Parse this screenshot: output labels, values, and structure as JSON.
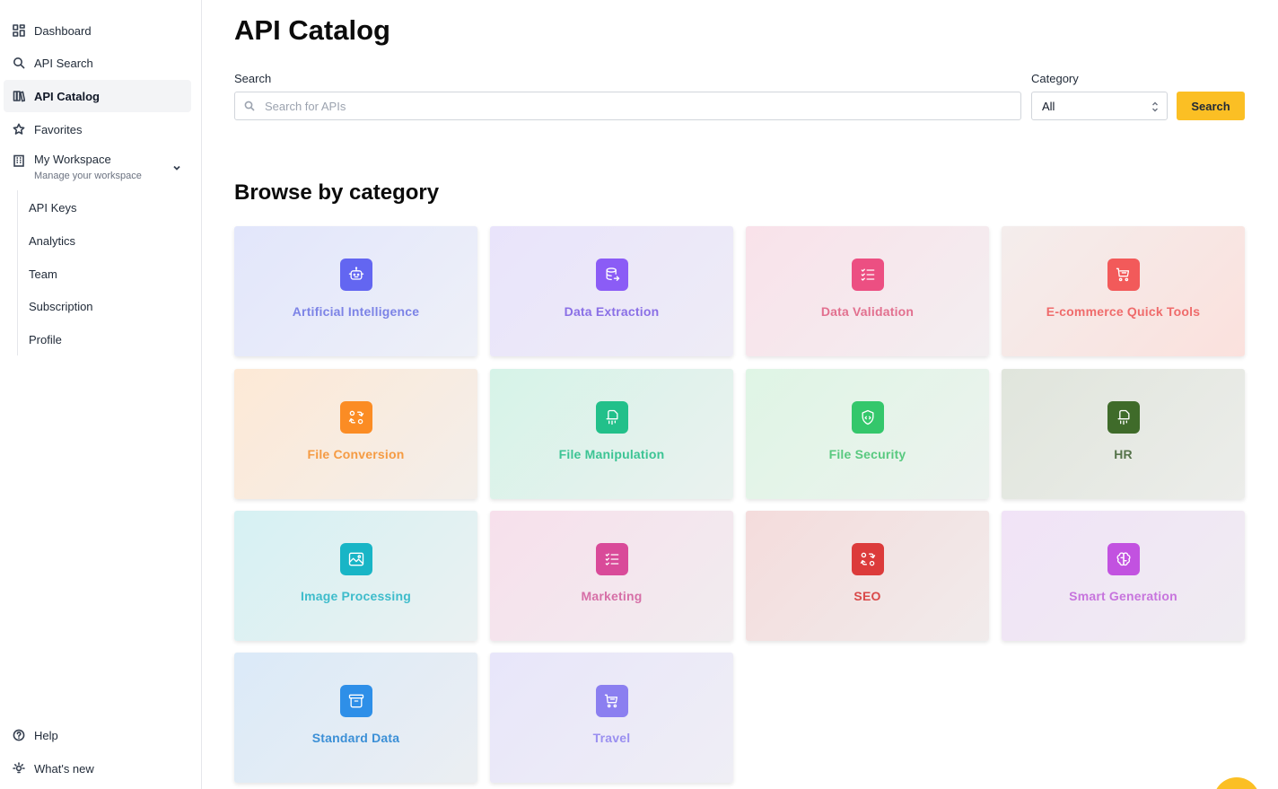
{
  "sidebar": {
    "items": [
      {
        "label": "Dashboard",
        "icon": "grid-icon"
      },
      {
        "label": "API Search",
        "icon": "search-icon"
      },
      {
        "label": "API Catalog",
        "icon": "books-icon",
        "active": true
      },
      {
        "label": "Favorites",
        "icon": "star-icon"
      }
    ],
    "workspace": {
      "label": "My Workspace",
      "sublabel": "Manage your workspace",
      "icon": "building-icon"
    },
    "sub_items": [
      "API Keys",
      "Analytics",
      "Team",
      "Subscription",
      "Profile"
    ],
    "bottom": [
      {
        "label": "Help",
        "icon": "help-circle-icon"
      },
      {
        "label": "What's new",
        "icon": "bulb-icon"
      }
    ]
  },
  "main": {
    "title": "API Catalog",
    "search_label": "Search",
    "search_placeholder": "Search for APIs",
    "category_label": "Category",
    "category_value": "All",
    "search_button": "Search",
    "section_title": "Browse by category"
  },
  "categories": [
    {
      "label": "Artificial Intelligence",
      "icon": "robot-icon",
      "accent": "#6366f1",
      "text": "#7c83e6",
      "bg1": "#e2e6fb",
      "bg2": "#eef0f8"
    },
    {
      "label": "Data Extraction",
      "icon": "database-export-icon",
      "accent": "#8b5cf6",
      "text": "#8a6fe6",
      "bg1": "#e9e4fb",
      "bg2": "#eeecf6"
    },
    {
      "label": "Data Validation",
      "icon": "list-check-icon",
      "accent": "#ec4f82",
      "text": "#e2708f",
      "bg1": "#f9e2ea",
      "bg2": "#f3eef0"
    },
    {
      "label": "E-commerce Quick Tools",
      "icon": "cart-icon",
      "accent": "#f25a5a",
      "text": "#ef6b6b",
      "bg1": "#f4edec",
      "bg2": "#fbe1dd"
    },
    {
      "label": "File Conversion",
      "icon": "transform-icon",
      "accent": "#fb8c24",
      "text": "#f59b43",
      "bg1": "#fde9d6",
      "bg2": "#f3eeea"
    },
    {
      "label": "File Manipulation",
      "icon": "file-cloud-icon",
      "accent": "#22c08a",
      "text": "#3cc494",
      "bg1": "#d6f3e8",
      "bg2": "#eaf2ef"
    },
    {
      "label": "File Security",
      "icon": "shield-code-icon",
      "accent": "#34c76b",
      "text": "#58c97f",
      "bg1": "#dff5e5",
      "bg2": "#ecf2ee"
    },
    {
      "label": "HR",
      "icon": "file-cloud-icon",
      "accent": "#3f6b2a",
      "text": "#55734a",
      "bg1": "#e0e5dc",
      "bg2": "#ecedea"
    },
    {
      "label": "Image Processing",
      "icon": "image-icon",
      "accent": "#18b5c6",
      "text": "#3ebccb",
      "bg1": "#d6f1f3",
      "bg2": "#eaf1f2"
    },
    {
      "label": "Marketing",
      "icon": "list-check-icon",
      "accent": "#d94a99",
      "text": "#d66fa7",
      "bg1": "#f7e0ec",
      "bg2": "#f1ecef"
    },
    {
      "label": "SEO",
      "icon": "transform-icon",
      "accent": "#dc3b3b",
      "text": "#d94949",
      "bg1": "#f4dcdc",
      "bg2": "#f1ebeb"
    },
    {
      "label": "Smart Generation",
      "icon": "brain-icon",
      "accent": "#c252e0",
      "text": "#c774dd",
      "bg1": "#f1e3f7",
      "bg2": "#efecf1"
    },
    {
      "label": "Standard Data",
      "icon": "archive-icon",
      "accent": "#2e8fe8",
      "text": "#3b8fd6",
      "bg1": "#dbeaf8",
      "bg2": "#ebeef2"
    },
    {
      "label": "Travel",
      "icon": "cart-icon",
      "accent": "#8b7ff0",
      "text": "#9a8ff0",
      "bg1": "#e8e6fa",
      "bg2": "#efeef5"
    }
  ]
}
